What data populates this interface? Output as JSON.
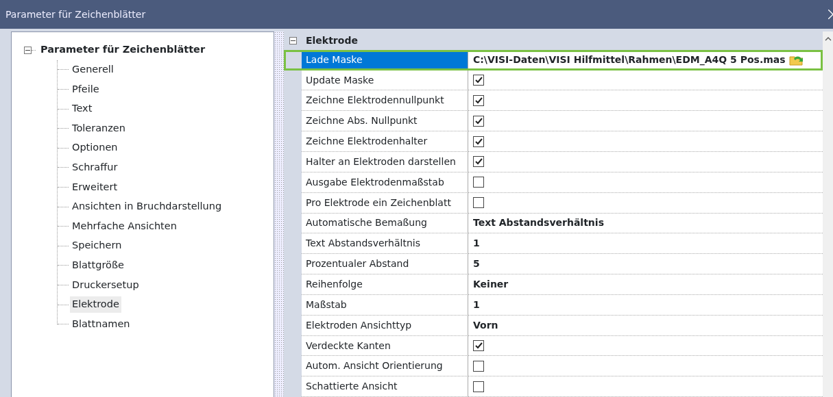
{
  "window": {
    "title": "Parameter für Zeichenblätter"
  },
  "tree": {
    "label": "Parameter für Zeichenblätter",
    "expanded": true,
    "children": [
      {
        "label": "Generell",
        "selected": false
      },
      {
        "label": "Pfeile",
        "selected": false
      },
      {
        "label": "Text",
        "selected": false
      },
      {
        "label": "Toleranzen",
        "selected": false
      },
      {
        "label": "Optionen",
        "selected": false
      },
      {
        "label": "Schraffur",
        "selected": false
      },
      {
        "label": "Erweitert",
        "selected": false
      },
      {
        "label": "Ansichten in Bruchdarstellung",
        "selected": false
      },
      {
        "label": "Mehrfache Ansichten",
        "selected": false
      },
      {
        "label": "Speichern",
        "selected": false
      },
      {
        "label": "Blattgröße",
        "selected": false
      },
      {
        "label": "Druckersetup",
        "selected": false
      },
      {
        "label": "Elektrode",
        "selected": true
      },
      {
        "label": "Blattnamen",
        "selected": false
      }
    ]
  },
  "grid": {
    "category": {
      "label": "Elektrode",
      "expanded": true
    },
    "rows": [
      {
        "label": "Lade Maske",
        "kind": "file",
        "value": "C:\\VISI-Daten\\VISI Hilfmittel\\Rahmen\\EDM_A4Q 5 Pos.mas",
        "selected": true
      },
      {
        "label": "Update Maske",
        "kind": "checkbox",
        "checked": true,
        "selected": false
      },
      {
        "label": "Zeichne Elektrodennullpunkt",
        "kind": "checkbox",
        "checked": true,
        "selected": false
      },
      {
        "label": "Zeichne Abs. Nullpunkt",
        "kind": "checkbox",
        "checked": true,
        "selected": false
      },
      {
        "label": "Zeichne Elektrodenhalter",
        "kind": "checkbox",
        "checked": true,
        "selected": false
      },
      {
        "label": "Halter an Elektroden darstellen",
        "kind": "checkbox",
        "checked": true,
        "selected": false
      },
      {
        "label": "Ausgabe Elektrodenmaßstab",
        "kind": "checkbox",
        "checked": false,
        "selected": false
      },
      {
        "label": "Pro Elektrode ein Zeichenblatt",
        "kind": "checkbox",
        "checked": false,
        "selected": false
      },
      {
        "label": "Automatische Bemaßung",
        "kind": "text",
        "value": "Text Abstandsverhältnis",
        "selected": false
      },
      {
        "label": "Text Abstandsverhältnis",
        "kind": "text",
        "value": "1",
        "selected": false
      },
      {
        "label": "Prozentualer Abstand",
        "kind": "text",
        "value": "5",
        "selected": false
      },
      {
        "label": "Reihenfolge",
        "kind": "text",
        "value": "Keiner",
        "selected": false
      },
      {
        "label": "Maßstab",
        "kind": "text",
        "value": "1",
        "selected": false
      },
      {
        "label": "Elektroden Ansichttyp",
        "kind": "text",
        "value": "Vorn",
        "selected": false
      },
      {
        "label": "Verdeckte Kanten",
        "kind": "checkbox",
        "checked": true,
        "selected": false
      },
      {
        "label": "Autom. Ansicht Orientierung",
        "kind": "checkbox",
        "checked": false,
        "selected": false
      },
      {
        "label": "Schattierte Ansicht",
        "kind": "checkbox",
        "checked": false,
        "selected": false
      }
    ]
  }
}
